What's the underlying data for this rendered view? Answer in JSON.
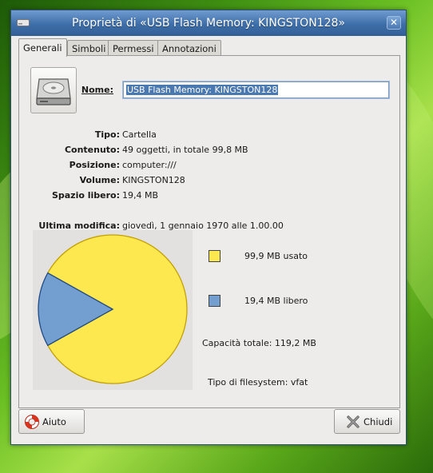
{
  "window": {
    "title": "Proprietà di «USB Flash Memory: KINGSTON128»",
    "close_glyph": "✕"
  },
  "tabs": [
    {
      "label": "Generali",
      "active": true
    },
    {
      "label": "Simboli",
      "active": false
    },
    {
      "label": "Permessi",
      "active": false
    },
    {
      "label": "Annotazioni",
      "active": false
    }
  ],
  "general": {
    "icon": "drive-harddisk-icon",
    "name_label": "Nome:",
    "name_value": "USB Flash Memory: KINGSTON128",
    "fields": [
      {
        "label": "Tipo:",
        "value": "Cartella"
      },
      {
        "label": "Contenuto:",
        "value": "49 oggetti, in totale 99,8 MB"
      },
      {
        "label": "Posizione:",
        "value": "computer:///"
      },
      {
        "label": "Volume:",
        "value": "KINGSTON128"
      },
      {
        "label": "Spazio libero:",
        "value": "19,4 MB"
      }
    ],
    "modified_label": "Ultima modifica:",
    "modified_value": "giovedì, 1 gennaio 1970 alle 1.00.00"
  },
  "usage": {
    "used_label": "99,9 MB usato",
    "free_label": "19,4 MB libero",
    "used_fraction": 0.838,
    "free_fraction": 0.162,
    "used_color": "#fde84f",
    "free_color": "#729fcf",
    "total_capacity": "Capacità totale: 119,2 MB",
    "filesystem": "Tipo di filesystem: vfat"
  },
  "buttons": {
    "help_label": "Aiuto",
    "help_icon": "lifebuoy-icon",
    "close_label": "Chiudi",
    "close_icon": "close-x-icon"
  }
}
